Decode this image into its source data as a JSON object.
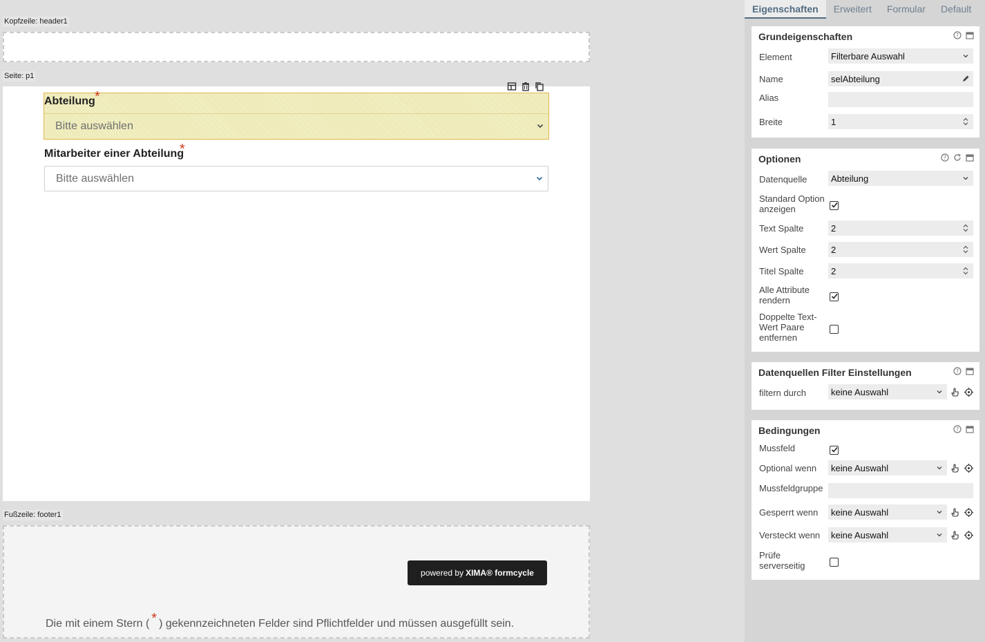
{
  "canvas": {
    "header_label": "Kopfzeile: header1",
    "page_label": "Seite: p1",
    "footer_label": "Fußzeile: footer1",
    "fields": [
      {
        "label": "Abteilung",
        "placeholder": "Bitte auswählen",
        "required_mark": "*"
      },
      {
        "label": "Mitarbeiter einer Abteilung",
        "placeholder": "Bitte auswählen",
        "required_mark": "*"
      }
    ],
    "powered_prefix": "powered by",
    "powered_brand": "XIMA® formcycle",
    "footer_note_before": "Die mit einem Stern (",
    "footer_note_star": "*",
    "footer_note_after": ") gekennzeichneten Felder sind Pflichtfelder und müssen ausgefüllt sein."
  },
  "panel": {
    "tabs": [
      "Eigenschaften",
      "Erweitert",
      "Formular",
      "Default"
    ],
    "active_tab": "Eigenschaften",
    "grund": {
      "title": "Grundeigenschaften",
      "element_label": "Element",
      "element_value": "Filterbare Auswahl",
      "name_label": "Name",
      "name_value": "selAbteilung",
      "alias_label": "Alias",
      "alias_value": "",
      "breite_label": "Breite",
      "breite_value": "1"
    },
    "optionen": {
      "title": "Optionen",
      "datenquelle_label": "Datenquelle",
      "datenquelle_value": "Abteilung",
      "std_option_label_1": "Standard Option",
      "std_option_label_2": "anzeigen",
      "std_option_checked": true,
      "text_spalte_label": "Text Spalte",
      "text_spalte_value": "2",
      "wert_spalte_label": "Wert Spalte",
      "wert_spalte_value": "2",
      "titel_spalte_label": "Titel Spalte",
      "titel_spalte_value": "2",
      "alle_attr_label_1": "Alle Attribute",
      "alle_attr_label_2": "rendern",
      "alle_attr_checked": true,
      "doppelte_label_1": "Doppelte Text-",
      "doppelte_label_2": "Wert Paare",
      "doppelte_label_3": "entfernen",
      "doppelte_checked": false
    },
    "filter": {
      "title": "Datenquellen Filter Einstellungen",
      "filtern_label": "filtern durch",
      "filtern_value": "keine Auswahl"
    },
    "bedingungen": {
      "title": "Bedingungen",
      "mussfeld_label": "Mussfeld",
      "mussfeld_checked": true,
      "optional_label": "Optional wenn",
      "optional_value": "keine Auswahl",
      "mussfeldgruppe_label": "Mussfeldgruppe",
      "mussfeldgruppe_value": "",
      "gesperrt_label": "Gesperrt wenn",
      "gesperrt_value": "keine Auswahl",
      "versteckt_label": "Versteckt wenn",
      "versteckt_value": "keine Auswahl",
      "pruefe_label_1": "Prüfe",
      "pruefe_label_2": "serverseitig",
      "pruefe_checked": false
    }
  },
  "colors": {
    "accent": "#526b83",
    "required": "#d03a1a",
    "selection_border": "#e0b64a"
  }
}
